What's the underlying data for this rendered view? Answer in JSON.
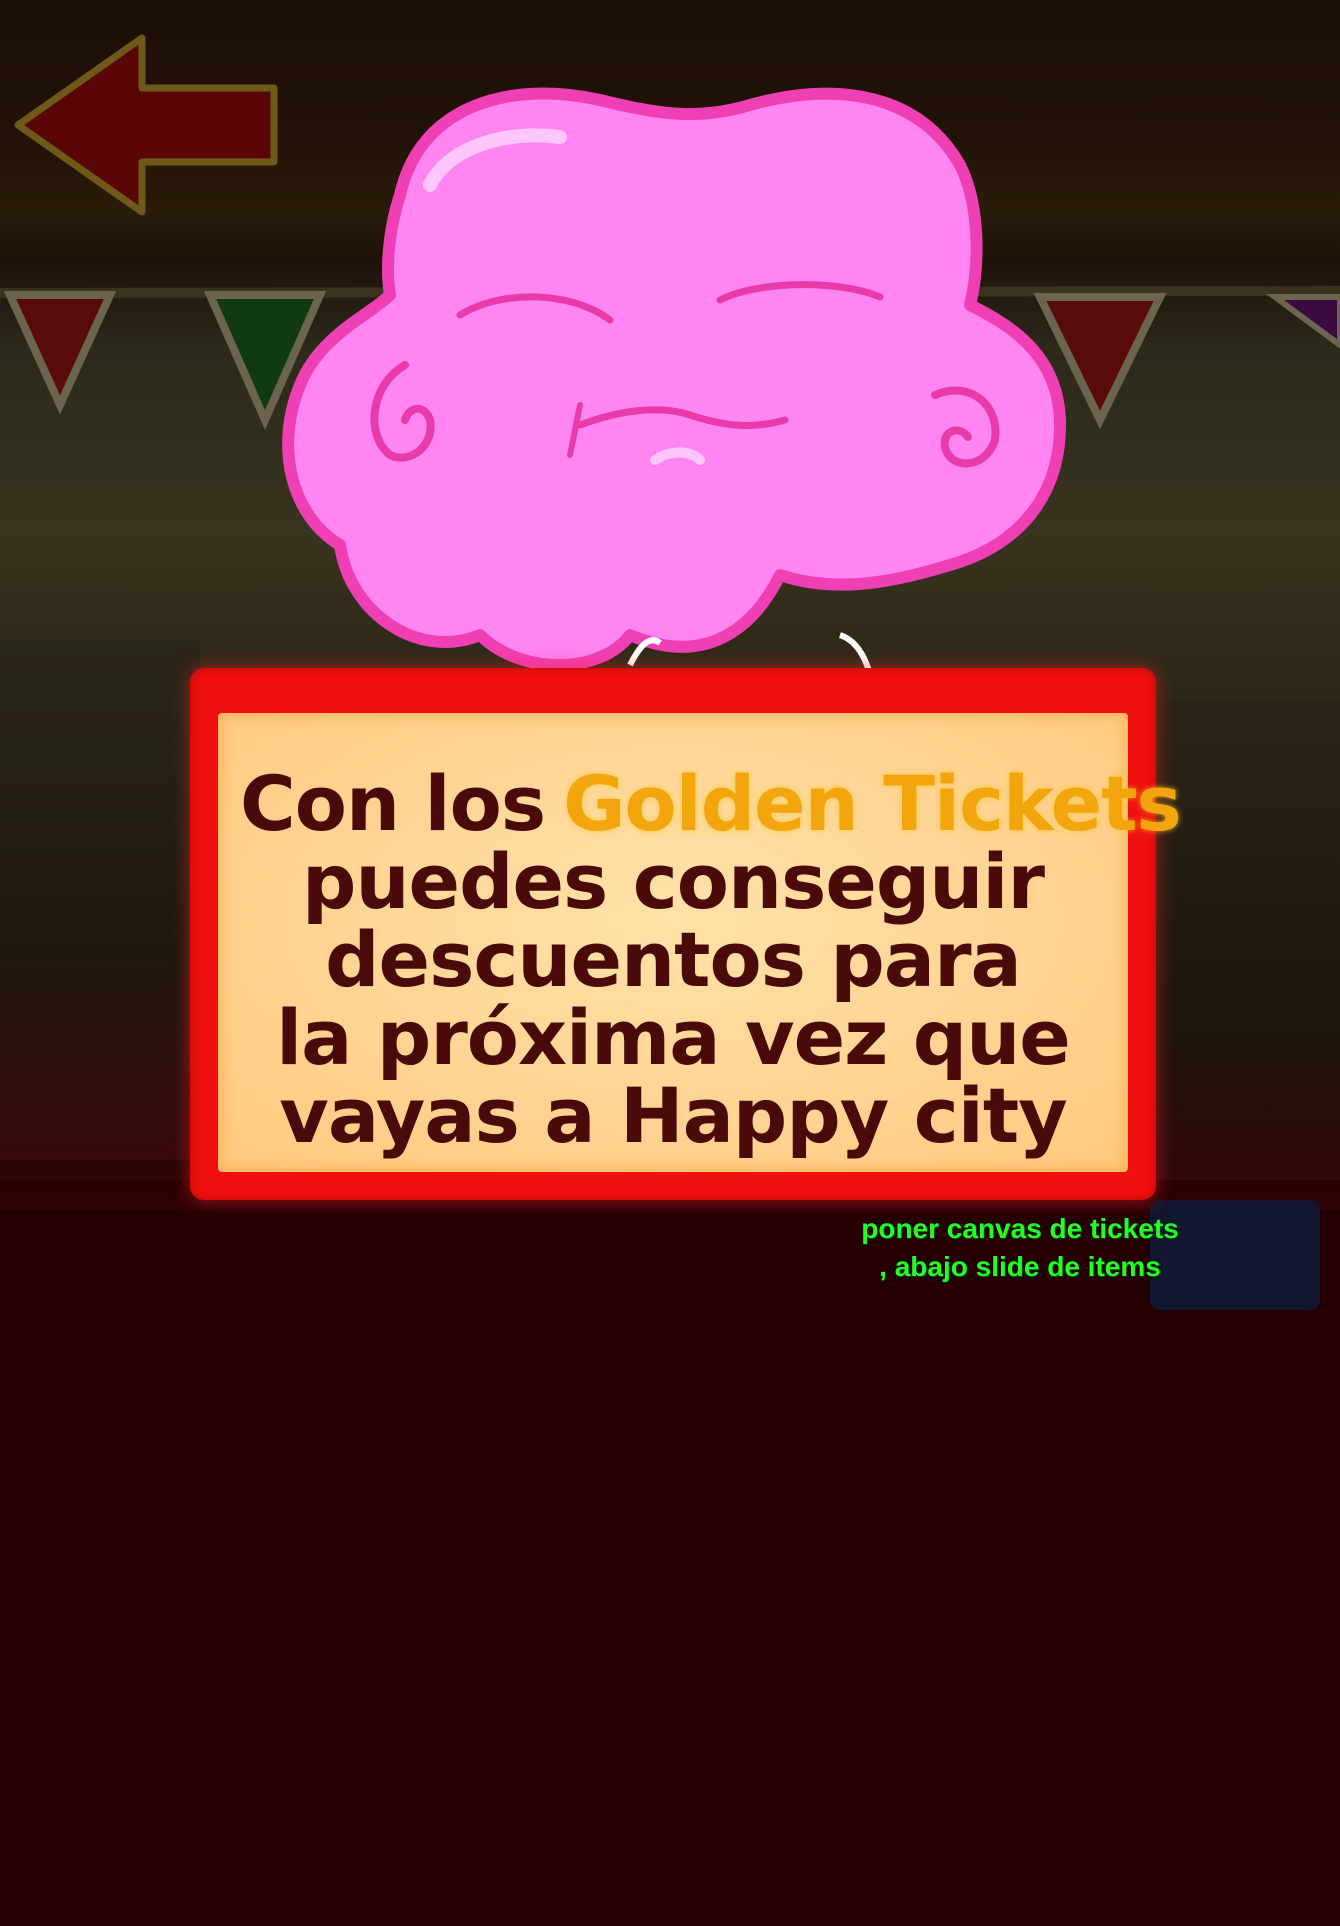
{
  "screen": {
    "name": "golden-tickets-tutorial"
  },
  "back_button": {
    "icon": "left-arrow-icon"
  },
  "mascot": {
    "icon": "pink-blob-mascot"
  },
  "dialog": {
    "line1_prefix": "Con los",
    "line1_highlight": "Golden Tickets",
    "line2": "puedes conseguir",
    "line3": "descuentos para",
    "line4": "la próxima vez que",
    "line5": "vayas a Happy city"
  },
  "dev_note": {
    "line1": "poner canvas de tickets",
    "line2": ", abajo slide de items"
  },
  "colors": {
    "dialog_border": "#f01010",
    "dialog_fill": "#ffd493",
    "dialog_text": "#4a0a0a",
    "highlight_text": "#f2a50d",
    "mascot_fill": "#ff88f0",
    "mascot_outline": "#f046b8",
    "dev_note_text": "#22ff22",
    "background_lower": "#250003"
  }
}
